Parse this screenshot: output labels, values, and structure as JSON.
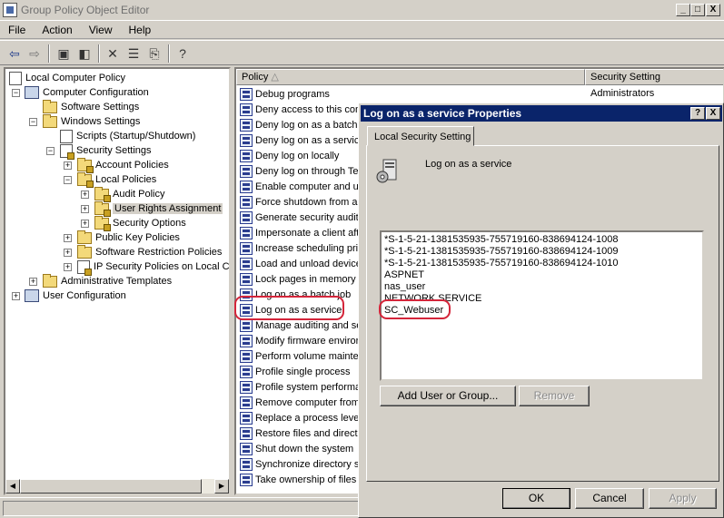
{
  "window": {
    "title": "Group Policy Object Editor",
    "minimize_label": "_",
    "maximize_label": "□",
    "close_label": "X"
  },
  "menu": [
    "File",
    "Action",
    "View",
    "Help"
  ],
  "tree": [
    "Local Computer Policy",
    "Computer Configuration",
    "Software Settings",
    "Windows Settings",
    "Scripts (Startup/Shutdown)",
    "Security Settings",
    "Account Policies",
    "Local Policies",
    "Audit Policy",
    "User Rights Assignment",
    "Security Options",
    "Public Key Policies",
    "Software Restriction Policies",
    "IP Security Policies on Local Co",
    "Administrative Templates",
    "User Configuration"
  ],
  "list": {
    "col_policy": "Policy",
    "col_setting": "Security Setting",
    "rows": [
      {
        "policy": "Debug programs",
        "setting": "Administrators"
      },
      {
        "policy": "Deny access to this com",
        "setting": ""
      },
      {
        "policy": "Deny log on as a batch",
        "setting": ""
      },
      {
        "policy": "Deny log on as a service",
        "setting": ""
      },
      {
        "policy": "Deny log on locally",
        "setting": ""
      },
      {
        "policy": "Deny log on through Te",
        "setting": ""
      },
      {
        "policy": "Enable computer and us",
        "setting": ""
      },
      {
        "policy": "Force shutdown from a",
        "setting": ""
      },
      {
        "policy": "Generate security audit",
        "setting": ""
      },
      {
        "policy": "Impersonate a client aft",
        "setting": ""
      },
      {
        "policy": "Increase scheduling pric",
        "setting": ""
      },
      {
        "policy": "Load and unload device",
        "setting": ""
      },
      {
        "policy": "Lock pages in memory",
        "setting": ""
      },
      {
        "policy": "Log on as a batch job",
        "setting": ""
      },
      {
        "policy": "Log on as a service",
        "setting": ""
      },
      {
        "policy": "Manage auditing and se",
        "setting": ""
      },
      {
        "policy": "Modify firmware enviror",
        "setting": ""
      },
      {
        "policy": "Perform volume mainter",
        "setting": ""
      },
      {
        "policy": "Profile single process",
        "setting": ""
      },
      {
        "policy": "Profile system performa",
        "setting": ""
      },
      {
        "policy": "Remove computer from",
        "setting": ""
      },
      {
        "policy": "Replace a process level",
        "setting": ""
      },
      {
        "policy": "Restore files and directo",
        "setting": ""
      },
      {
        "policy": "Shut down the system",
        "setting": ""
      },
      {
        "policy": "Synchronize directory s",
        "setting": ""
      },
      {
        "policy": "Take ownership of files",
        "setting": ""
      }
    ]
  },
  "dialog": {
    "title": "Log on as a service Properties",
    "help_label": "?",
    "close_label": "X",
    "tab": "Local Security Setting",
    "policy_name": "Log on as a service",
    "accounts": [
      "*S-1-5-21-1381535935-755719160-838694124-1008",
      "*S-1-5-21-1381535935-755719160-838694124-1009",
      "*S-1-5-21-1381535935-755719160-838694124-1010",
      "ASPNET",
      "nas_user",
      "NETWORK SERVICE",
      "SC_Webuser"
    ],
    "add_button": "Add User or Group...",
    "remove_button": "Remove",
    "ok": "OK",
    "cancel": "Cancel",
    "apply": "Apply"
  },
  "colors": {
    "highlight": "#d4253a",
    "title_active": "#0a246a"
  }
}
